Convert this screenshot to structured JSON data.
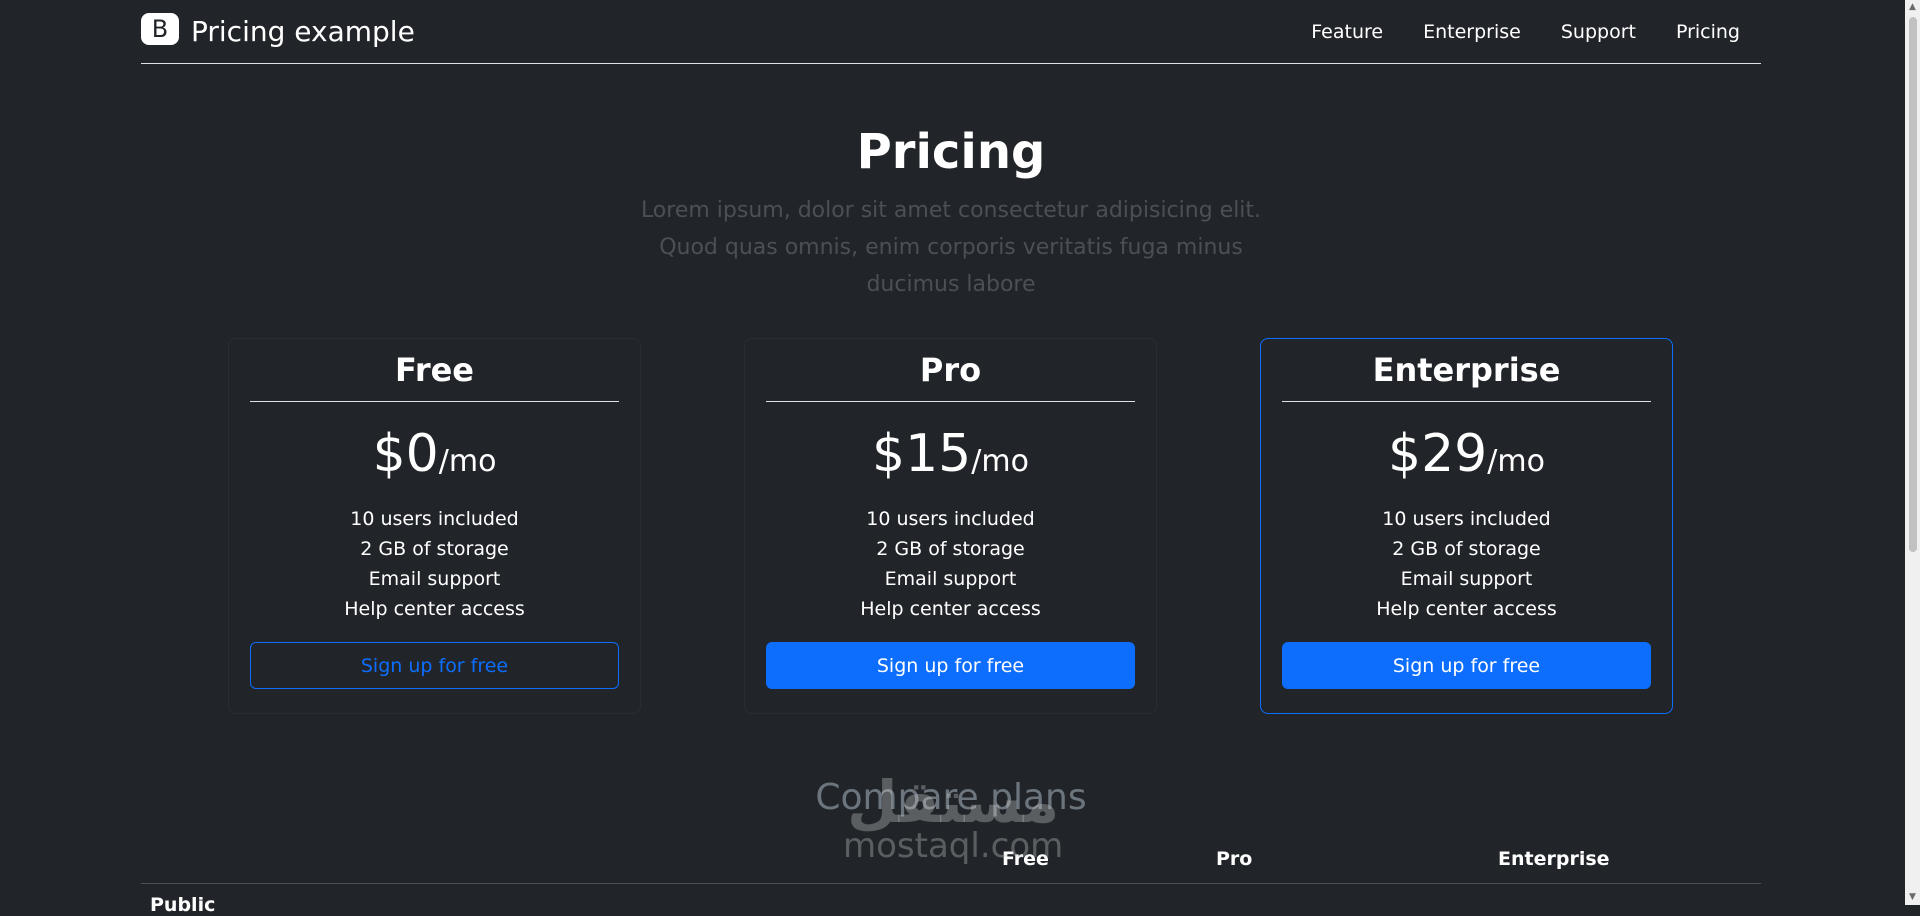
{
  "header": {
    "logo_letter": "B",
    "brand": "Pricing example",
    "nav": [
      "Feature",
      "Enterprise",
      "Support",
      "Pricing"
    ]
  },
  "hero": {
    "title": "Pricing",
    "lead": "Lorem ipsum, dolor sit amet consectetur adipisicing elit. Quod quas omnis, enim corporis veritatis fuga minus ducimus labore"
  },
  "plans": [
    {
      "name": "Free",
      "price": "$0",
      "unit": "/mo",
      "features": [
        "10 users included",
        "2 GB of storage",
        "Email support",
        "Help center access"
      ],
      "button": "Sign up for free",
      "button_style": "outline"
    },
    {
      "name": "Pro",
      "price": "$15",
      "unit": "/mo",
      "features": [
        "10 users included",
        "2 GB of storage",
        "Email support",
        "Help center access"
      ],
      "button": "Sign up for free",
      "button_style": "solid"
    },
    {
      "name": "Enterprise",
      "price": "$29",
      "unit": "/mo",
      "features": [
        "10 users included",
        "2 GB of storage",
        "Email support",
        "Help center access"
      ],
      "button": "Sign up for free",
      "button_style": "solid",
      "highlighted": true
    }
  ],
  "compare": {
    "title": "Compare plans",
    "columns": [
      "Free",
      "Pro",
      "Enterprise"
    ],
    "first_row_label": "Public"
  },
  "watermark": {
    "arabic": "مستقل",
    "latin": "mostaql.com"
  },
  "colors": {
    "background": "#212529",
    "accent": "#0d6efd",
    "muted": "#4b5057"
  }
}
